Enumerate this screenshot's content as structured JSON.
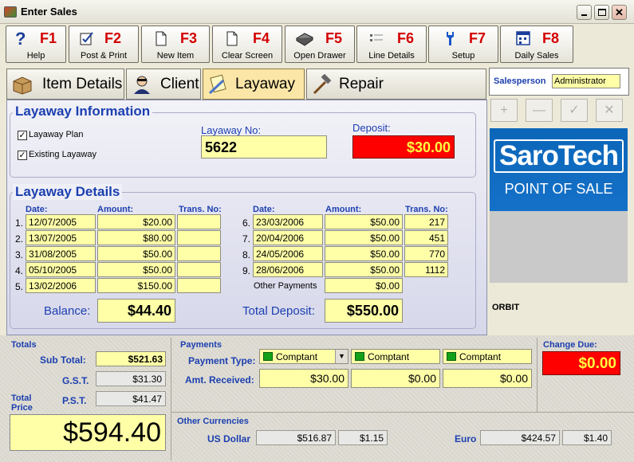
{
  "window": {
    "title": "Enter Sales"
  },
  "fkeys": [
    {
      "key": "F1",
      "label": "Help",
      "icon": "help-icon"
    },
    {
      "key": "F2",
      "label": "Post & Print",
      "icon": "post-print-icon"
    },
    {
      "key": "F3",
      "label": "New Item",
      "icon": "new-item-icon"
    },
    {
      "key": "F4",
      "label": "Clear Screen",
      "icon": "clear-screen-icon"
    },
    {
      "key": "F5",
      "label": "Open Drawer",
      "icon": "drawer-icon"
    },
    {
      "key": "F6",
      "label": "Line Details",
      "icon": "line-details-icon"
    },
    {
      "key": "F7",
      "label": "Setup",
      "icon": "wrench-icon"
    },
    {
      "key": "F8",
      "label": "Daily Sales",
      "icon": "calendar-icon"
    }
  ],
  "tabs": [
    {
      "label": "Item Details",
      "icon": "box-icon",
      "active": false
    },
    {
      "label": "Client",
      "icon": "client-icon",
      "active": false
    },
    {
      "label": "Layaway",
      "icon": "note-icon",
      "active": true
    },
    {
      "label": "Repair",
      "icon": "hammer-icon",
      "active": false
    }
  ],
  "layaway_info": {
    "title": "Layaway Information",
    "plan_label": "Layaway Plan",
    "plan_checked": true,
    "existing_label": "Existing Layaway",
    "existing_checked": true,
    "no_label": "Layaway No:",
    "no_value": "5622",
    "deposit_label": "Deposit:",
    "deposit_value": "$30.00"
  },
  "layaway_details": {
    "title": "Layaway Details",
    "headers": {
      "date": "Date:",
      "amount": "Amount:",
      "trans": "Trans. No:"
    },
    "left_rows": [
      {
        "n": "1.",
        "date": "12/07/2005",
        "amount": "$20.00",
        "trans": ""
      },
      {
        "n": "2.",
        "date": "13/07/2005",
        "amount": "$80.00",
        "trans": ""
      },
      {
        "n": "3.",
        "date": "31/08/2005",
        "amount": "$50.00",
        "trans": ""
      },
      {
        "n": "4.",
        "date": "05/10/2005",
        "amount": "$50.00",
        "trans": ""
      },
      {
        "n": "5.",
        "date": "13/02/2006",
        "amount": "$150.00",
        "trans": ""
      }
    ],
    "right_rows": [
      {
        "n": "6.",
        "date": "23/03/2006",
        "amount": "$50.00",
        "trans": "217"
      },
      {
        "n": "7.",
        "date": "20/04/2006",
        "amount": "$50.00",
        "trans": "451"
      },
      {
        "n": "8.",
        "date": "24/05/2006",
        "amount": "$50.00",
        "trans": "770"
      },
      {
        "n": "9.",
        "date": "28/06/2006",
        "amount": "$50.00",
        "trans": "1112"
      }
    ],
    "other_payments_label": "Other Payments",
    "other_payments_value": "$0.00",
    "balance_label": "Balance:",
    "balance_value": "$44.40",
    "total_deposit_label": "Total Deposit:",
    "total_deposit_value": "$550.00"
  },
  "sidebar": {
    "salesperson_label": "Salesperson",
    "salesperson_value": "Administrator",
    "tools": [
      "+",
      "—",
      "✓",
      "✕"
    ],
    "logo_top": "SaroTech",
    "logo_bottom": "POINT OF SALE",
    "orbit_label": "ORBIT"
  },
  "totals": {
    "title": "Totals",
    "subtotal_label": "Sub Total:",
    "subtotal_value": "$521.63",
    "gst_label": "G.S.T.",
    "gst_value": "$31.30",
    "pst_label": "P.S.T.",
    "pst_value": "$41.47",
    "total_price_label": "Total Price",
    "total_price_value": "$594.40"
  },
  "payments": {
    "title": "Payments",
    "type_label": "Payment Type:",
    "received_label": "Amt. Received:",
    "types": [
      "Comptant",
      "Comptant",
      "Comptant"
    ],
    "received": [
      "$30.00",
      "$0.00",
      "$0.00"
    ]
  },
  "change": {
    "label": "Change Due:",
    "value": "$0.00"
  },
  "currencies": {
    "title": "Other Currencies",
    "usd_label": "US Dollar",
    "usd_amount": "$516.87",
    "usd_rate": "$1.15",
    "eur_label": "Euro",
    "eur_amount": "$424.57",
    "eur_rate": "$1.40"
  },
  "colors": {
    "accent_blue": "#1c3fb0",
    "deposit_red": "#ff0000",
    "field_yellow": "#ffffa8",
    "fkey_red": "#d30000"
  }
}
